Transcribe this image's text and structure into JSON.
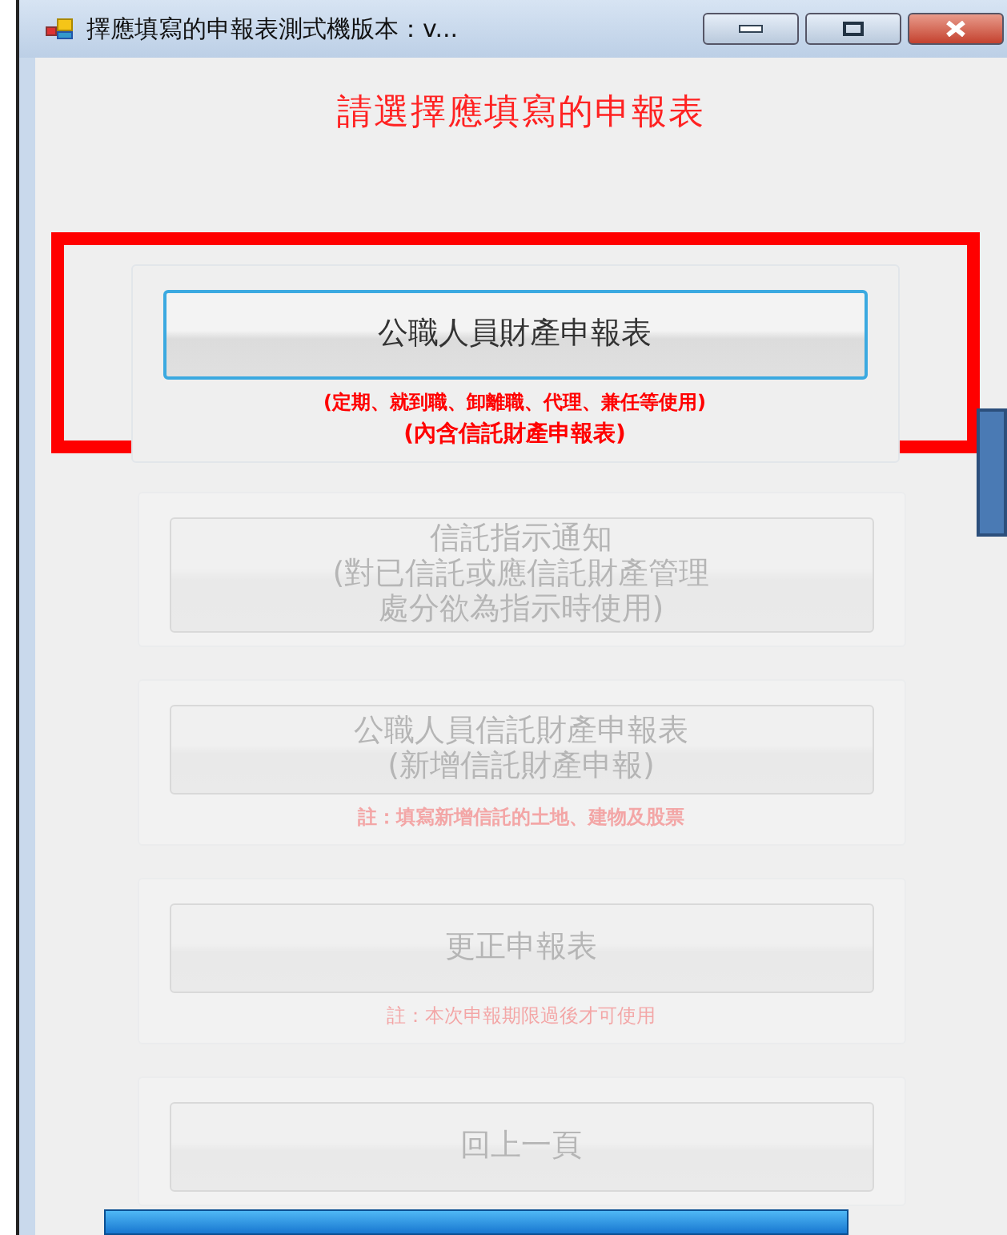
{
  "window": {
    "title": "擇應填寫的申報表測式機版本：v..."
  },
  "heading": "請選擇應填寫的申報表",
  "sections": [
    {
      "label_lines": [
        "公職人員財產申報表"
      ],
      "notes": [
        "(定期、就到職、卸離職、代理、兼任等使用)",
        "(內含信託財產申報表)"
      ],
      "notes_bold": true,
      "dimmed": false,
      "highlighted": true
    },
    {
      "label_lines": [
        "信託指示通知",
        "(對已信託或應信託財產管理",
        "處分欲為指示時使用)"
      ],
      "dimmed": true,
      "highlighted": false
    },
    {
      "label_lines": [
        "公職人員信託財產申報表",
        "(新增信託財產申報)"
      ],
      "notes": [
        "註：填寫新增信託的土地、建物及股票"
      ],
      "notes_bold": true,
      "dimmed": true,
      "highlighted": false
    },
    {
      "label_lines": [
        "更正申報表"
      ],
      "notes": [
        "註：本次申報期限過後才可使用"
      ],
      "notes_bold": false,
      "dimmed": true,
      "highlighted": false
    },
    {
      "label_lines": [
        "回上一頁"
      ],
      "dimmed": true,
      "highlighted": false
    }
  ]
}
